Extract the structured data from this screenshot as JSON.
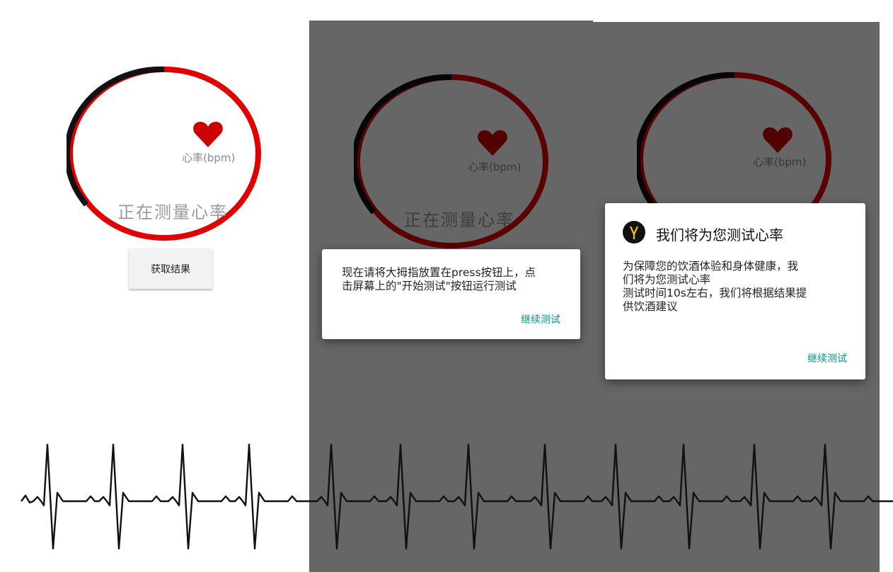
{
  "heart_rate": {
    "unit_label": "心率(bpm)",
    "status_text": "正在测量心率"
  },
  "screen1": {
    "get_result_button": "获取结果"
  },
  "dialog_instruction": {
    "message": "现在请将大拇指放置在press按钮上，点\n击屏幕上的\"开始测试\"按钮运行测试",
    "action": "继续测试"
  },
  "dialog_intro": {
    "title": "我们将为您测试心率",
    "message": "   为保障您的饮酒体验和身体健康，我\n们将为您测试心率\n   测试时间10s左右，我们将根据结果提\n供饮酒建议",
    "action": "继续测试",
    "icon": "app-logo-icon"
  },
  "colors": {
    "ring_red": "#e00000",
    "ring_black": "#111111",
    "heart_red": "#cc0000",
    "accent_teal": "#009688",
    "overlay_dim": "#5f5f5f"
  }
}
